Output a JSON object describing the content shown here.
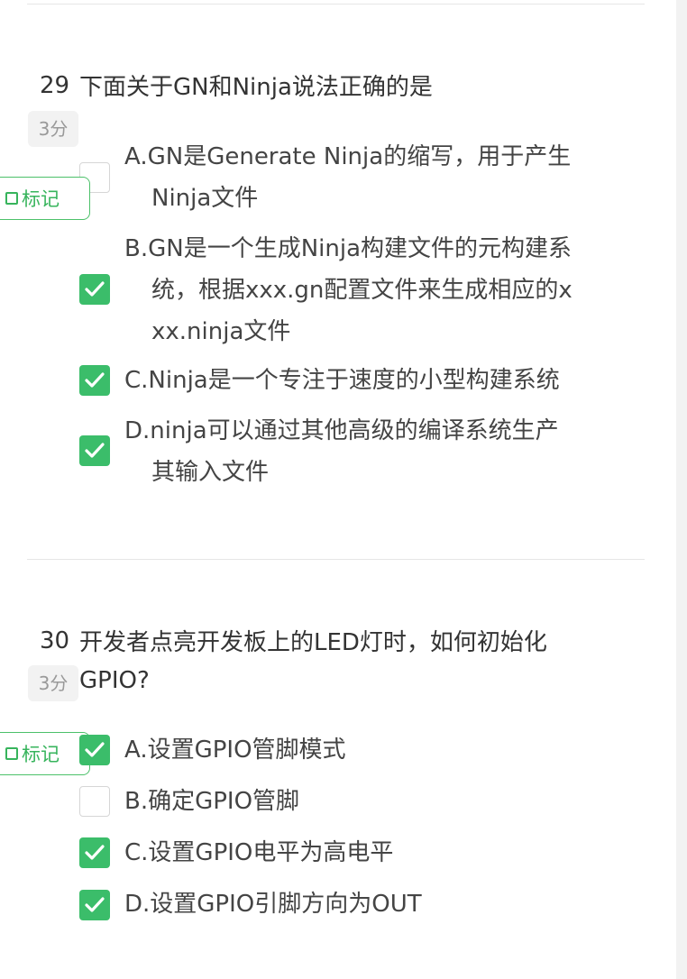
{
  "questions": [
    {
      "number": "29",
      "title": "下面关于GN和Ninja说法正确的是",
      "score": "3分",
      "mark_label": "标记",
      "options": [
        {
          "line1": "A.GN是Generate Ninja的缩写，用于产生",
          "line2": "Ninja文件",
          "checked": false
        },
        {
          "line1": "B.GN是一个生成Ninja构建文件的元构建系",
          "line2": "统，根据xxx.gn配置文件来生成相应的x",
          "line3": "xx.ninja文件",
          "checked": true
        },
        {
          "line1": "C.Ninja是一个专注于速度的小型构建系统",
          "checked": true
        },
        {
          "line1": "D.ninja可以通过其他高级的编译系统生产",
          "line2": "其输入文件",
          "checked": true
        }
      ]
    },
    {
      "number": "30",
      "title_line1": "开发者点亮开发板上的LED灯时，如何初始化",
      "title_line2": "GPIO?",
      "score": "3分",
      "mark_label": "标记",
      "options": [
        {
          "line1": "A.设置GPIO管脚模式",
          "checked": true
        },
        {
          "line1": "B.确定GPIO管脚",
          "checked": false
        },
        {
          "line1": "C.设置GPIO电平为高电平",
          "checked": true
        },
        {
          "line1": "D.设置GPIO引脚方向为OUT",
          "checked": true
        }
      ]
    }
  ],
  "colors": {
    "accent": "#3bbd6a",
    "mark": "#37b45c",
    "text": "#333333",
    "score_bg": "#f2f2f2"
  }
}
